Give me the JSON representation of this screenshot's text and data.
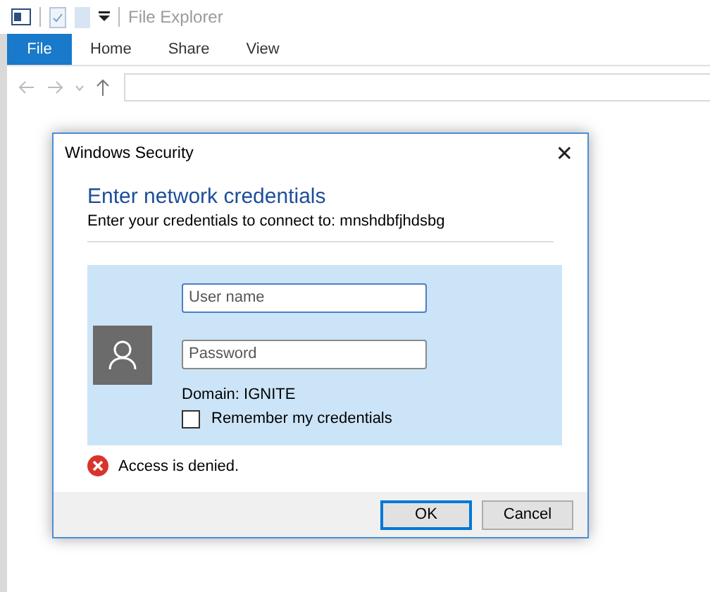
{
  "explorer": {
    "title": "File Explorer",
    "tabs": [
      {
        "label": "File",
        "selected": true
      },
      {
        "label": "Home",
        "selected": false
      },
      {
        "label": "Share",
        "selected": false
      },
      {
        "label": "View",
        "selected": false
      }
    ]
  },
  "dialog": {
    "title": "Windows Security",
    "close": "✕",
    "heading": "Enter network credentials",
    "subtitle": "Enter your credentials to connect to: mnshdbfjhdsbg",
    "username": {
      "placeholder": "User name",
      "focused": true
    },
    "password": {
      "placeholder": "Password"
    },
    "domain": "Domain: IGNITE",
    "remember": {
      "label": "Remember my credentials",
      "checked": false
    },
    "error": "Access is denied.",
    "buttons": [
      {
        "label": "OK",
        "default": true
      },
      {
        "label": "Cancel",
        "default": false
      }
    ]
  }
}
